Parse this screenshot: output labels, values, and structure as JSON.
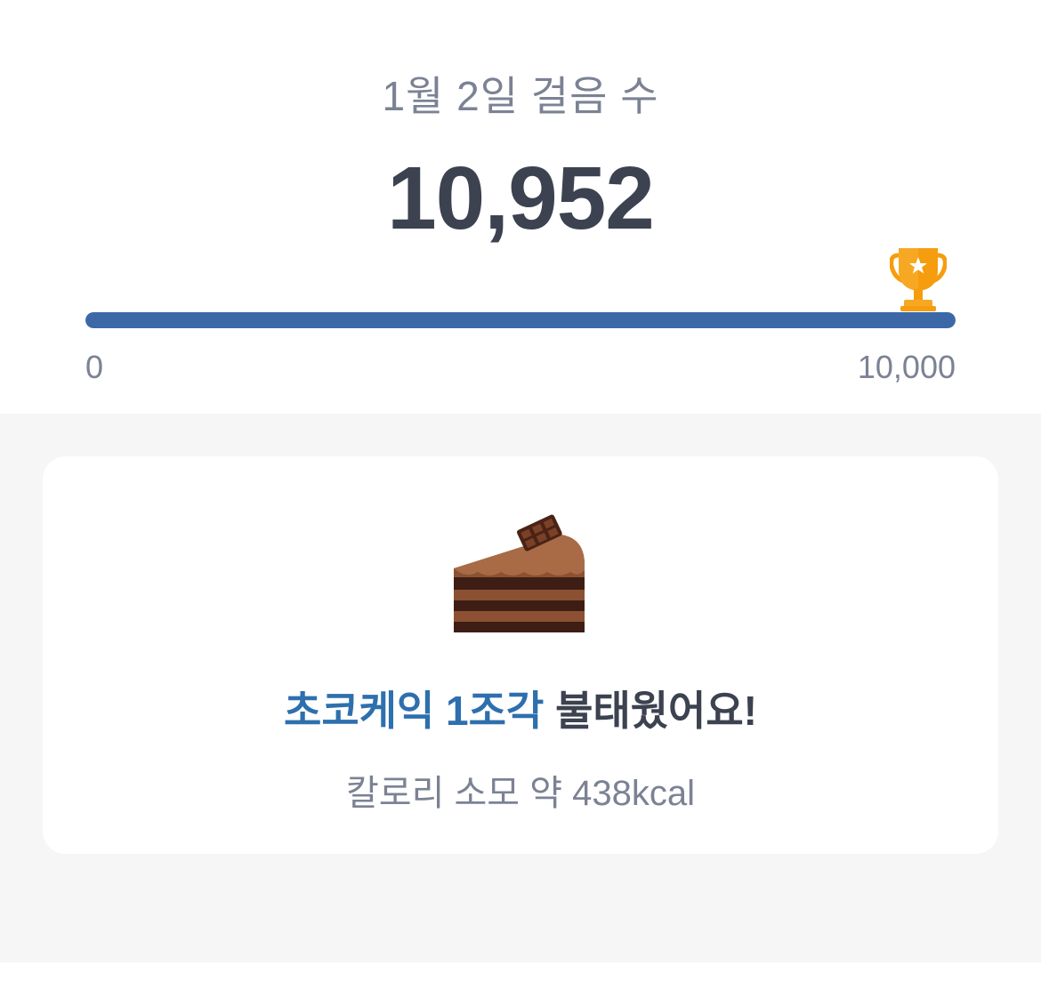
{
  "header": {
    "date_label": "1월 2일 걸음 수",
    "step_count": "10,952"
  },
  "progress": {
    "value": 10952,
    "goal": 10000,
    "fraction": 1.0,
    "min_label": "0",
    "max_label": "10,000",
    "bar_color": "#3d68a8",
    "goal_icon": "trophy-icon",
    "trophy_color": "#f7a823"
  },
  "calorie_card": {
    "icon": "chocolate-cake-icon",
    "food_highlight": "초코케익 1조각",
    "headline_rest": " 불태웠어요!",
    "subtext": "칼로리 소모 약 438kcal",
    "accent_color": "#2e6fae"
  }
}
